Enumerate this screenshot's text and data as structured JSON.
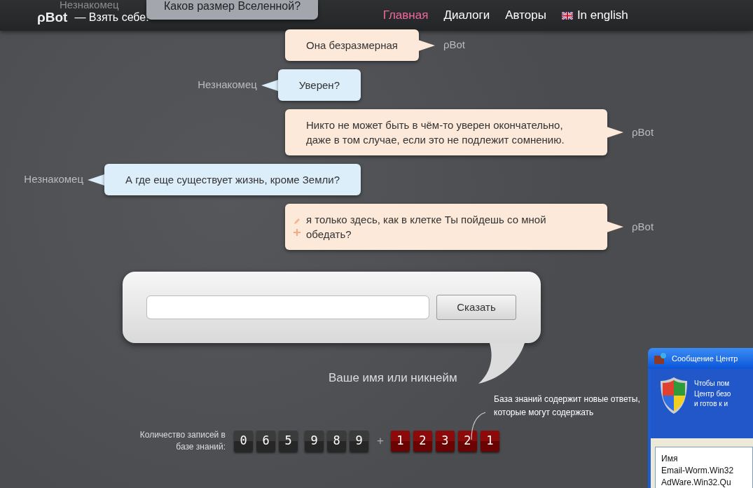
{
  "navbar": {
    "logo": "ρBot",
    "tagline": "— Взять себе!",
    "links": [
      {
        "label": "Главная",
        "selected": true,
        "kind": "page"
      },
      {
        "label": "Диалоги",
        "selected": false,
        "kind": "page"
      },
      {
        "label": "Авторы",
        "selected": false,
        "kind": "page"
      },
      {
        "label": "In english",
        "selected": false,
        "kind": "language"
      }
    ]
  },
  "previous_message": {
    "speaker": "Незнакомец",
    "text": "Каков размер Вселенной?"
  },
  "messages": [
    {
      "kind": "bot",
      "speaker": "ρBot",
      "text": "Она безразмерная",
      "editable": false
    },
    {
      "kind": "user",
      "speaker": "Незнакомец",
      "text": "Уверен?",
      "editable": false
    },
    {
      "kind": "bot",
      "speaker": "ρBot",
      "text": "Никто не может быть в чём-то уверен окончательно, даже в том случае, если это не подлежит сомнению.",
      "editable": false
    },
    {
      "kind": "user",
      "speaker": "Незнакомец",
      "text": "А где еще существует жизнь, кроме Земли?",
      "editable": false
    },
    {
      "kind": "bot",
      "speaker": "ρBot",
      "text": "я только здесь, как в клетке Ты пойдешь со мной обедать?",
      "editable": true
    }
  ],
  "form": {
    "button": "Сказать",
    "name_hint": "Ваше имя или никнейм"
  },
  "counter": {
    "note": "База знаний содержит новые ответы, которые могут содержать",
    "label": "Количество записей в базе знаний:",
    "digit_groups": [
      [
        "0",
        "6",
        "5"
      ],
      [
        "9",
        "8",
        "9"
      ]
    ],
    "plus": "+",
    "new_digits": [
      "1",
      "2",
      "3",
      "2",
      "1"
    ]
  },
  "popup_window": {
    "title": "Сообщение Центр",
    "lines": [
      "Чтобы пом",
      "Центр безо",
      "и готов к и"
    ],
    "list_header": "Имя",
    "items": [
      "Email-Worm.Win32",
      "AdWare.Win32.Qu"
    ]
  }
}
